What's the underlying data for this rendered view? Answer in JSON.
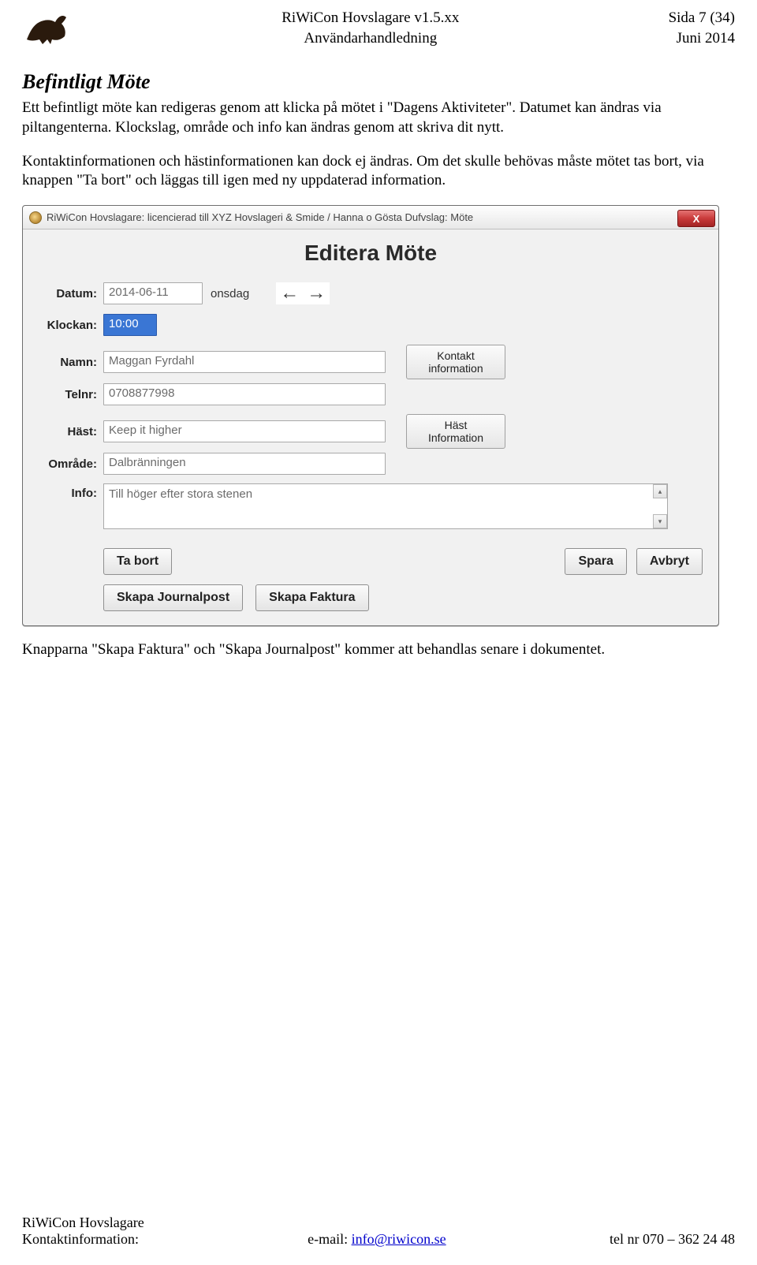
{
  "header": {
    "center_line1": "RiWiCon Hovslagare v1.5.xx",
    "center_line2": "Användarhandledning",
    "right_line1": "Sida 7 (34)",
    "right_line2": "Juni 2014"
  },
  "section_title": "Befintligt Möte",
  "para1": "Ett befintligt möte kan redigeras genom att klicka på mötet i \"Dagens Aktiviteter\". Datumet kan ändras via piltangenterna. Klockslag, område och info kan ändras genom att skriva dit nytt.",
  "para2": "Kontaktinformationen och hästinformationen kan dock ej ändras. Om det skulle behövas måste mötet tas bort, via knappen \"Ta bort\" och läggas till igen med ny uppdaterad information.",
  "app": {
    "titlebar": "RiWiCon Hovslagare: licencierad till XYZ Hovslageri & Smide / Hanna o Gösta Dufvslag: Möte",
    "close_glyph": "X",
    "dialog_title": "Editera Möte",
    "labels": {
      "datum": "Datum:",
      "klockan": "Klockan:",
      "namn": "Namn:",
      "telnr": "Telnr:",
      "hast": "Häst:",
      "omrade": "Område:",
      "info": "Info:"
    },
    "values": {
      "datum": "2014-06-11",
      "weekday": "onsdag",
      "klockan": "10:00",
      "namn": "Maggan Fyrdahl",
      "telnr": "0708877998",
      "hast": "Keep it higher",
      "omrade": "Dalbränningen",
      "info": "Till höger efter stora stenen"
    },
    "arrows": {
      "left": "←",
      "right": "→"
    },
    "side_buttons": {
      "kontakt": "Kontakt\ninformation",
      "hast": "Häst\nInformation"
    },
    "buttons": {
      "ta_bort": "Ta bort",
      "spara": "Spara",
      "avbryt": "Avbryt",
      "skapa_journalpost": "Skapa Journalpost",
      "skapa_faktura": "Skapa Faktura"
    }
  },
  "para3": "Knapparna \"Skapa Faktura\" och \"Skapa Journalpost\" kommer att behandlas senare i dokumentet.",
  "footer": {
    "left_line1": "RiWiCon Hovslagare",
    "left_line2": "Kontaktinformation:",
    "center_prefix": "e-mail: ",
    "center_link": "info@riwicon.se",
    "right": "tel nr 070 – 362 24 48"
  }
}
